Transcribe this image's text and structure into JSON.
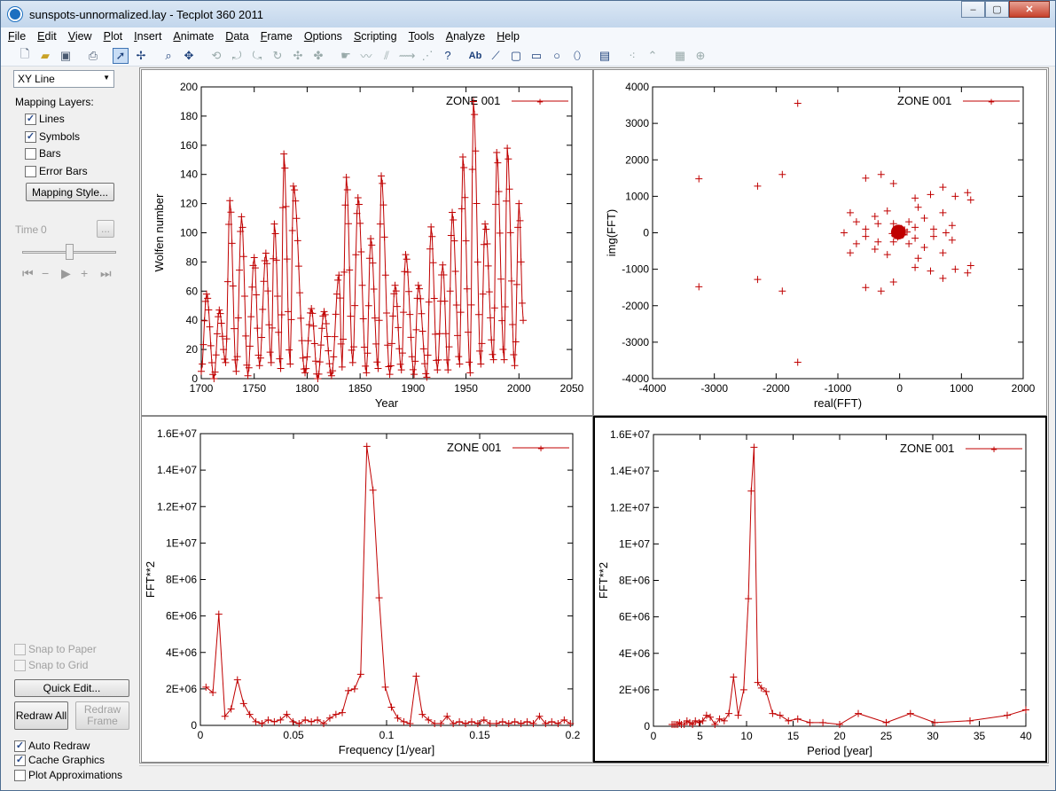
{
  "window": {
    "title": "sunspots-unnormalized.lay - Tecplot 360 2011",
    "controls": {
      "minimize": "–",
      "maximize": "▢",
      "close": "✕"
    }
  },
  "menu": [
    "File",
    "Edit",
    "View",
    "Plot",
    "Insert",
    "Animate",
    "Data",
    "Frame",
    "Options",
    "Scripting",
    "Tools",
    "Analyze",
    "Help"
  ],
  "toolbar_icons": [
    "new-icon",
    "open-icon",
    "save-icon",
    "print-icon",
    "select-arrow-icon",
    "adjustor-icon",
    "zoom-icon",
    "translate-icon",
    "rotate-icon",
    "probe-icon",
    "text-tool-icon",
    "polyline-icon",
    "rectangle-icon",
    "square-icon",
    "circle-icon",
    "ellipse-icon",
    "frame-icon",
    "scatter-icon",
    "grid-icon"
  ],
  "sidebar": {
    "plot_type": "XY Line",
    "mapping_layers_label": "Mapping Layers:",
    "layers": [
      {
        "label": "Lines",
        "checked": true
      },
      {
        "label": "Symbols",
        "checked": true
      },
      {
        "label": "Bars",
        "checked": false
      },
      {
        "label": "Error Bars",
        "checked": false
      }
    ],
    "mapping_style_button": "Mapping Style...",
    "time_label": "Time",
    "time_value": "0",
    "time_more": "...",
    "snap_to_paper": "Snap to Paper",
    "snap_to_grid": "Snap to Grid",
    "quick_edit": "Quick Edit...",
    "redraw_all": "Redraw All",
    "redraw_frame": "Redraw Frame",
    "auto_redraw": "Auto Redraw",
    "cache_graphics": "Cache Graphics",
    "plot_approximations": "Plot Approximations",
    "auto_redraw_checked": true,
    "cache_graphics_checked": true,
    "plot_approximations_checked": false
  },
  "colors": {
    "series": "#c00000",
    "active_frame_border": "#000000"
  },
  "chart_data": [
    {
      "type": "line",
      "legend": "ZONE 001",
      "xlabel": "Year",
      "ylabel": "Wolfen number",
      "xlim": [
        1700,
        2050
      ],
      "ylim": [
        0,
        200
      ],
      "xticks": [
        "1700",
        "1750",
        "1800",
        "1850",
        "1900",
        "1950",
        "2000",
        "2050"
      ],
      "yticks": [
        "0",
        "20",
        "40",
        "60",
        "80",
        "100",
        "120",
        "140",
        "160",
        "180",
        "200"
      ],
      "peaks": [
        [
          1705,
          58
        ],
        [
          1717,
          47
        ],
        [
          1727,
          122
        ],
        [
          1738,
          111
        ],
        [
          1750,
          83
        ],
        [
          1761,
          86
        ],
        [
          1769,
          106
        ],
        [
          1778,
          154
        ],
        [
          1787,
          132
        ],
        [
          1804,
          48
        ],
        [
          1816,
          46
        ],
        [
          1830,
          71
        ],
        [
          1837,
          138
        ],
        [
          1848,
          124
        ],
        [
          1860,
          96
        ],
        [
          1870,
          139
        ],
        [
          1883,
          64
        ],
        [
          1893,
          85
        ],
        [
          1905,
          64
        ],
        [
          1917,
          104
        ],
        [
          1928,
          78
        ],
        [
          1937,
          114
        ],
        [
          1947,
          152
        ],
        [
          1957,
          190
        ],
        [
          1968,
          106
        ],
        [
          1979,
          155
        ],
        [
          1989,
          158
        ],
        [
          2000,
          120
        ]
      ],
      "minima": [
        [
          1700,
          5
        ],
        [
          1712,
          0
        ],
        [
          1723,
          11
        ],
        [
          1733,
          5
        ],
        [
          1744,
          2
        ],
        [
          1755,
          9
        ],
        [
          1766,
          11
        ],
        [
          1775,
          7
        ],
        [
          1784,
          10
        ],
        [
          1798,
          4
        ],
        [
          1810,
          0
        ],
        [
          1823,
          2
        ],
        [
          1833,
          8
        ],
        [
          1843,
          11
        ],
        [
          1856,
          4
        ],
        [
          1867,
          7
        ],
        [
          1878,
          3
        ],
        [
          1889,
          6
        ],
        [
          1901,
          3
        ],
        [
          1913,
          1
        ],
        [
          1923,
          6
        ],
        [
          1933,
          6
        ],
        [
          1944,
          10
        ],
        [
          1954,
          4
        ],
        [
          1964,
          10
        ],
        [
          1976,
          13
        ],
        [
          1986,
          13
        ],
        [
          1996,
          9
        ]
      ],
      "x_end": 2004,
      "y_end": 40
    },
    {
      "type": "scatter",
      "legend": "ZONE 001",
      "xlabel": "real(FFT)",
      "ylabel": "img(FFT)",
      "xlim": [
        -4000,
        2000
      ],
      "ylim": [
        -4000,
        4000
      ],
      "xticks": [
        "-4000",
        "-3000",
        "-2000",
        "-1000",
        "0",
        "1000",
        "2000"
      ],
      "yticks": [
        "-4000",
        "-3000",
        "-2000",
        "-1000",
        "0",
        "1000",
        "2000",
        "3000",
        "4000"
      ],
      "points": [
        [
          -1650,
          3550
        ],
        [
          -1650,
          -3550
        ],
        [
          -3250,
          1480
        ],
        [
          -3250,
          -1480
        ],
        [
          -2300,
          1280
        ],
        [
          -2300,
          -1280
        ],
        [
          -1900,
          1600
        ],
        [
          -1900,
          -1600
        ],
        [
          -550,
          1500
        ],
        [
          -550,
          -1500
        ],
        [
          -300,
          1600
        ],
        [
          -300,
          -1600
        ],
        [
          -100,
          1350
        ],
        [
          -100,
          -1350
        ],
        [
          700,
          1250
        ],
        [
          700,
          -1250
        ],
        [
          1100,
          1100
        ],
        [
          1100,
          -1100
        ],
        [
          1150,
          900
        ],
        [
          1150,
          -900
        ],
        [
          900,
          1000
        ],
        [
          900,
          -1000
        ],
        [
          500,
          1050
        ],
        [
          500,
          -1050
        ],
        [
          250,
          950
        ],
        [
          250,
          -950
        ],
        [
          -800,
          550
        ],
        [
          -800,
          -550
        ],
        [
          -700,
          300
        ],
        [
          -700,
          -300
        ],
        [
          -400,
          450
        ],
        [
          -400,
          -450
        ],
        [
          700,
          550
        ],
        [
          700,
          -550
        ],
        [
          850,
          200
        ],
        [
          850,
          -200
        ],
        [
          400,
          400
        ],
        [
          400,
          -400
        ],
        [
          -550,
          100
        ],
        [
          -550,
          -100
        ],
        [
          300,
          700
        ],
        [
          300,
          -700
        ],
        [
          -200,
          600
        ],
        [
          -200,
          -600
        ],
        [
          550,
          100
        ],
        [
          550,
          -100
        ],
        [
          -100,
          250
        ],
        [
          -100,
          -250
        ],
        [
          150,
          300
        ],
        [
          150,
          -300
        ],
        [
          -900,
          0
        ],
        [
          750,
          0
        ],
        [
          -350,
          250
        ],
        [
          -350,
          -250
        ],
        [
          250,
          150
        ],
        [
          250,
          -150
        ],
        [
          0,
          0
        ],
        [
          -50,
          60
        ],
        [
          50,
          -60
        ],
        [
          80,
          80
        ],
        [
          -80,
          -80
        ],
        [
          30,
          120
        ],
        [
          -30,
          -120
        ],
        [
          120,
          20
        ],
        [
          -120,
          -20
        ],
        [
          60,
          -40
        ],
        [
          -60,
          40
        ]
      ],
      "dense_cluster": {
        "x": -20,
        "y": 20,
        "radius": 120
      }
    },
    {
      "type": "line",
      "legend": "ZONE 001",
      "xlabel": "Frequency [1/year]",
      "ylabel": "FFT**2",
      "xlim": [
        0,
        0.2
      ],
      "ylim": [
        0,
        16000000
      ],
      "xticks": [
        "0",
        "0.05",
        "0.1",
        "0.15",
        "0.2"
      ],
      "yticks": [
        "0",
        "2E+06",
        "4E+06",
        "6E+06",
        "8E+06",
        "1E+07",
        "1.2E+07",
        "1.4E+07",
        "1.6E+07"
      ],
      "x": [
        0.003,
        0.0067,
        0.0099,
        0.0132,
        0.0165,
        0.0199,
        0.0232,
        0.0265,
        0.0298,
        0.0331,
        0.0364,
        0.0397,
        0.043,
        0.0464,
        0.0497,
        0.053,
        0.0563,
        0.0596,
        0.0629,
        0.0662,
        0.0695,
        0.0728,
        0.0762,
        0.0795,
        0.0828,
        0.0861,
        0.0894,
        0.0927,
        0.096,
        0.0993,
        0.1026,
        0.106,
        0.1093,
        0.1126,
        0.1159,
        0.1192,
        0.1225,
        0.1258,
        0.1291,
        0.1325,
        0.1358,
        0.1391,
        0.1424,
        0.1457,
        0.149,
        0.1523,
        0.1556,
        0.159,
        0.1623,
        0.1656,
        0.1689,
        0.1722,
        0.1755,
        0.1788,
        0.1821,
        0.1854,
        0.1887,
        0.1921,
        0.1954,
        0.1987
      ],
      "y": [
        2100000,
        1800000,
        6100000,
        500000,
        900000,
        2500000,
        1200000,
        600000,
        200000,
        100000,
        300000,
        200000,
        300000,
        600000,
        200000,
        100000,
        300000,
        200000,
        300000,
        100000,
        400000,
        600000,
        700000,
        1900000,
        2000000,
        2800000,
        15300000,
        12900000,
        7000000,
        2100000,
        1000000,
        400000,
        200000,
        100000,
        2700000,
        600000,
        300000,
        100000,
        100000,
        500000,
        100000,
        200000,
        100000,
        200000,
        100000,
        300000,
        100000,
        100000,
        200000,
        100000,
        200000,
        100000,
        200000,
        100000,
        500000,
        100000,
        200000,
        100000,
        300000,
        100000
      ]
    },
    {
      "type": "line",
      "legend": "ZONE 001",
      "xlabel": "Period [year]",
      "ylabel": "FFT**2",
      "xlim": [
        0,
        40
      ],
      "ylim": [
        0,
        16000000
      ],
      "xticks": [
        "0",
        "5",
        "10",
        "15",
        "20",
        "25",
        "30",
        "35",
        "40"
      ],
      "yticks": [
        "0",
        "2E+06",
        "4E+06",
        "6E+06",
        "8E+06",
        "1E+07",
        "1.2E+07",
        "1.4E+07",
        "1.6E+07"
      ],
      "x": [
        2,
        2.2,
        2.4,
        2.6,
        2.8,
        3,
        3.3,
        3.6,
        3.9,
        4.2,
        4.5,
        4.9,
        5.3,
        5.7,
        6.1,
        6.6,
        7.1,
        7.6,
        8.1,
        8.6,
        9.1,
        9.7,
        10.2,
        10.5,
        10.8,
        11.2,
        11.6,
        12.1,
        12.8,
        13.6,
        14.5,
        15.5,
        16.8,
        18.2,
        20,
        22,
        25,
        27.6,
        30.2,
        34,
        38,
        40
      ],
      "y": [
        100000,
        100000,
        100000,
        100000,
        200000,
        100000,
        100000,
        300000,
        200000,
        100000,
        300000,
        200000,
        300000,
        600000,
        500000,
        100000,
        400000,
        300000,
        700000,
        2700000,
        600000,
        2000000,
        7000000,
        12900000,
        15300000,
        2400000,
        2100000,
        1900000,
        700000,
        600000,
        300000,
        400000,
        200000,
        200000,
        100000,
        700000,
        200000,
        700000,
        200000,
        300000,
        600000,
        900000
      ]
    }
  ]
}
